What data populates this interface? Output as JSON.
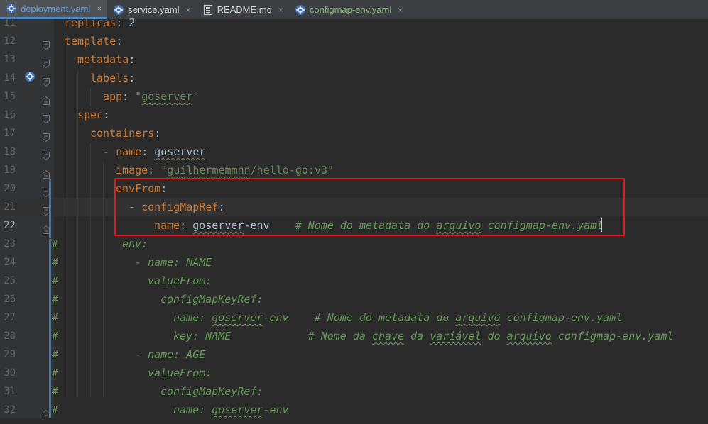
{
  "tabs": [
    {
      "label": "deployment.yaml",
      "active": true,
      "icon": "yaml-k8s-icon",
      "closable": true
    },
    {
      "label": "service.yaml",
      "active": false,
      "icon": "yaml-k8s-icon",
      "closable": true
    },
    {
      "label": "README.md",
      "active": false,
      "icon": "markdown-file-icon",
      "closable": true
    },
    {
      "label": "configmap-env.yaml",
      "active": false,
      "icon": "yaml-k8s-icon",
      "closable": true
    }
  ],
  "close_glyph": "×",
  "editor": {
    "current_line": 22,
    "lines": [
      {
        "n": "11",
        "parts": [
          [
            "k",
            "replicas"
          ],
          [
            "w",
            ": 2"
          ]
        ]
      },
      {
        "n": "12",
        "parts": [
          [
            "k",
            "template"
          ],
          [
            "w",
            ":"
          ]
        ]
      },
      {
        "n": "13",
        "parts": [
          [
            "k",
            "metadata"
          ],
          [
            "w",
            ":"
          ]
        ]
      },
      {
        "n": "14",
        "parts": [
          [
            "k",
            "labels"
          ],
          [
            "w",
            ":"
          ]
        ]
      },
      {
        "n": "15",
        "parts": [
          [
            "k",
            "app"
          ],
          [
            "w",
            ": "
          ],
          [
            "s",
            "\"goserver\""
          ]
        ]
      },
      {
        "n": "16",
        "parts": [
          [
            "k",
            "spec"
          ],
          [
            "w",
            ":"
          ]
        ]
      },
      {
        "n": "17",
        "parts": [
          [
            "k",
            "containers"
          ],
          [
            "w",
            ":"
          ]
        ]
      },
      {
        "n": "18",
        "parts": [
          [
            "w",
            "- "
          ],
          [
            "k",
            "name"
          ],
          [
            "w",
            ": goserver"
          ]
        ]
      },
      {
        "n": "19",
        "parts": [
          [
            "k",
            "image"
          ],
          [
            "w",
            ": "
          ],
          [
            "s",
            "\"guilhermemmnn/hello-go:v3\""
          ]
        ]
      },
      {
        "n": "20",
        "parts": [
          [
            "k",
            "envFrom"
          ],
          [
            "w",
            ":"
          ]
        ]
      },
      {
        "n": "21",
        "parts": [
          [
            "w",
            "- "
          ],
          [
            "k",
            "configMapRef"
          ],
          [
            "w",
            ":"
          ]
        ]
      },
      {
        "n": "22",
        "parts": [
          [
            "k",
            "name"
          ],
          [
            "w",
            ": goserver-env    "
          ],
          [
            "c",
            "# Nome do metadata do arquivo configmap-env.yaml"
          ]
        ]
      },
      {
        "n": "23",
        "parts": [
          [
            "c",
            "env:"
          ]
        ]
      },
      {
        "n": "24",
        "parts": [
          [
            "c",
            "- name: NAME"
          ]
        ]
      },
      {
        "n": "25",
        "parts": [
          [
            "c",
            "valueFrom:"
          ]
        ]
      },
      {
        "n": "26",
        "parts": [
          [
            "c",
            "configMapKeyRef:"
          ]
        ]
      },
      {
        "n": "27",
        "parts": [
          [
            "c",
            "name: goserver-env    # Nome do metadata do arquivo configmap-env.yaml"
          ]
        ]
      },
      {
        "n": "28",
        "parts": [
          [
            "c",
            "key: NAME            # Nome da chave da variável do arquivo configmap-env.yaml"
          ]
        ]
      },
      {
        "n": "29",
        "parts": [
          [
            "c",
            "- name: AGE"
          ]
        ]
      },
      {
        "n": "30",
        "parts": [
          [
            "c",
            "valueFrom:"
          ]
        ]
      },
      {
        "n": "31",
        "parts": [
          [
            "c",
            "configMapKeyRef:"
          ]
        ]
      },
      {
        "n": "32",
        "parts": [
          [
            "c",
            "name: goserver-env"
          ]
        ]
      }
    ],
    "comment_prefix": "#"
  },
  "colors": {
    "keyword": "#cc7832",
    "text": "#a9b7c6",
    "string": "#6a8759",
    "comment": "#629755",
    "highlight_box": "#e01b1b"
  }
}
